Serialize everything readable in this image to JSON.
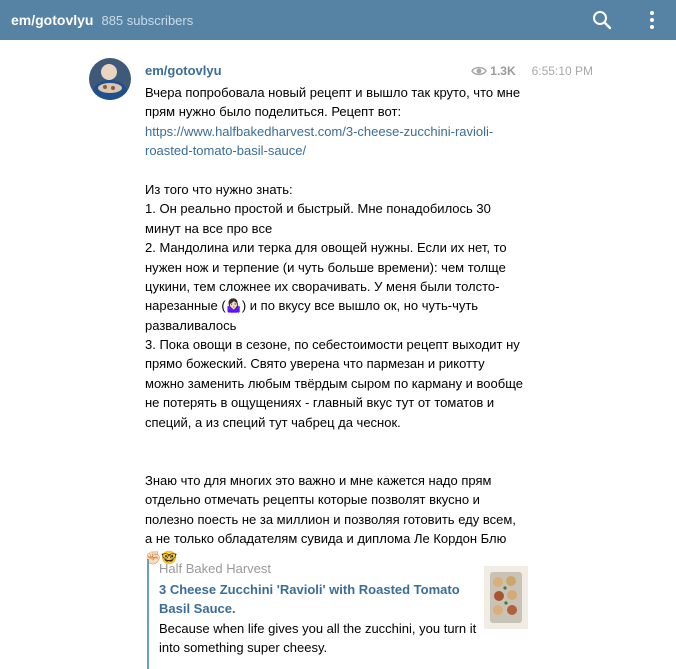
{
  "header": {
    "title": "em/gotovlyu",
    "subscribers": "885 subscribers",
    "search_icon": "search-icon",
    "menu_icon": "more-vert-icon"
  },
  "message": {
    "author": "em/gotovlyu",
    "views": "1.3K",
    "time": "6:55:10 PM",
    "lines": [
      "Вчера попробовала новый рецепт и вышло так круто, что мне",
      "прям нужно было поделиться. Рецепт вот:"
    ],
    "link_lines": [
      "https://www.halfbakedharvest.com/3-cheese-zucchini-ravioli-",
      "roasted-tomato-basil-sauce/"
    ],
    "body_lines": [
      "Из того что нужно знать:",
      "1. Он реально простой и быстрый. Мне понадобилось 30",
      "минут на все про все",
      "2. Мандолина или терка для овощей нужны. Если их нет, то",
      "нужен нож и терпение (и чуть больше времени): чем толще",
      "цукини, тем сложнее их сворачивать. У меня были толсто-",
      "нарезанные (🤷🏻‍♀️) и по вкусу все вышло ок, но чуть-чуть",
      "разваливалось",
      "3. Пока овощи в сезоне, по себестоимости рецепт выходит ну",
      "прямо божеский. Свято уверена что пармезан и рикотту",
      "можно заменить любым твёрдым сыром по карману и вообще",
      "не потерять в ощущениях - главный вкус тут от томатов и",
      "специй, а из специй тут чабрец да чеснок."
    ],
    "tail_lines": [
      "Знаю что для многих это важно и мне кажется надо прям",
      "отдельно отмечать рецепты которые позволят вкусно и",
      "полезно поесть не за миллион и позволяя готовить еду всем,",
      "а не только обладателям сувида и диплома Ле Кордон Блю",
      "✊🏻🤓"
    ]
  },
  "preview": {
    "site": "Half Baked Harvest",
    "title": "3 Cheese Zucchini 'Ravioli' with Roasted Tomato Basil Sauce.",
    "description": "Because when life gives you all the zucchini, you turn it into something super cheesy."
  },
  "colors": {
    "header_bg": "#5682a3",
    "link": "#3a6d99",
    "preview_bar": "#6b9dc5"
  }
}
